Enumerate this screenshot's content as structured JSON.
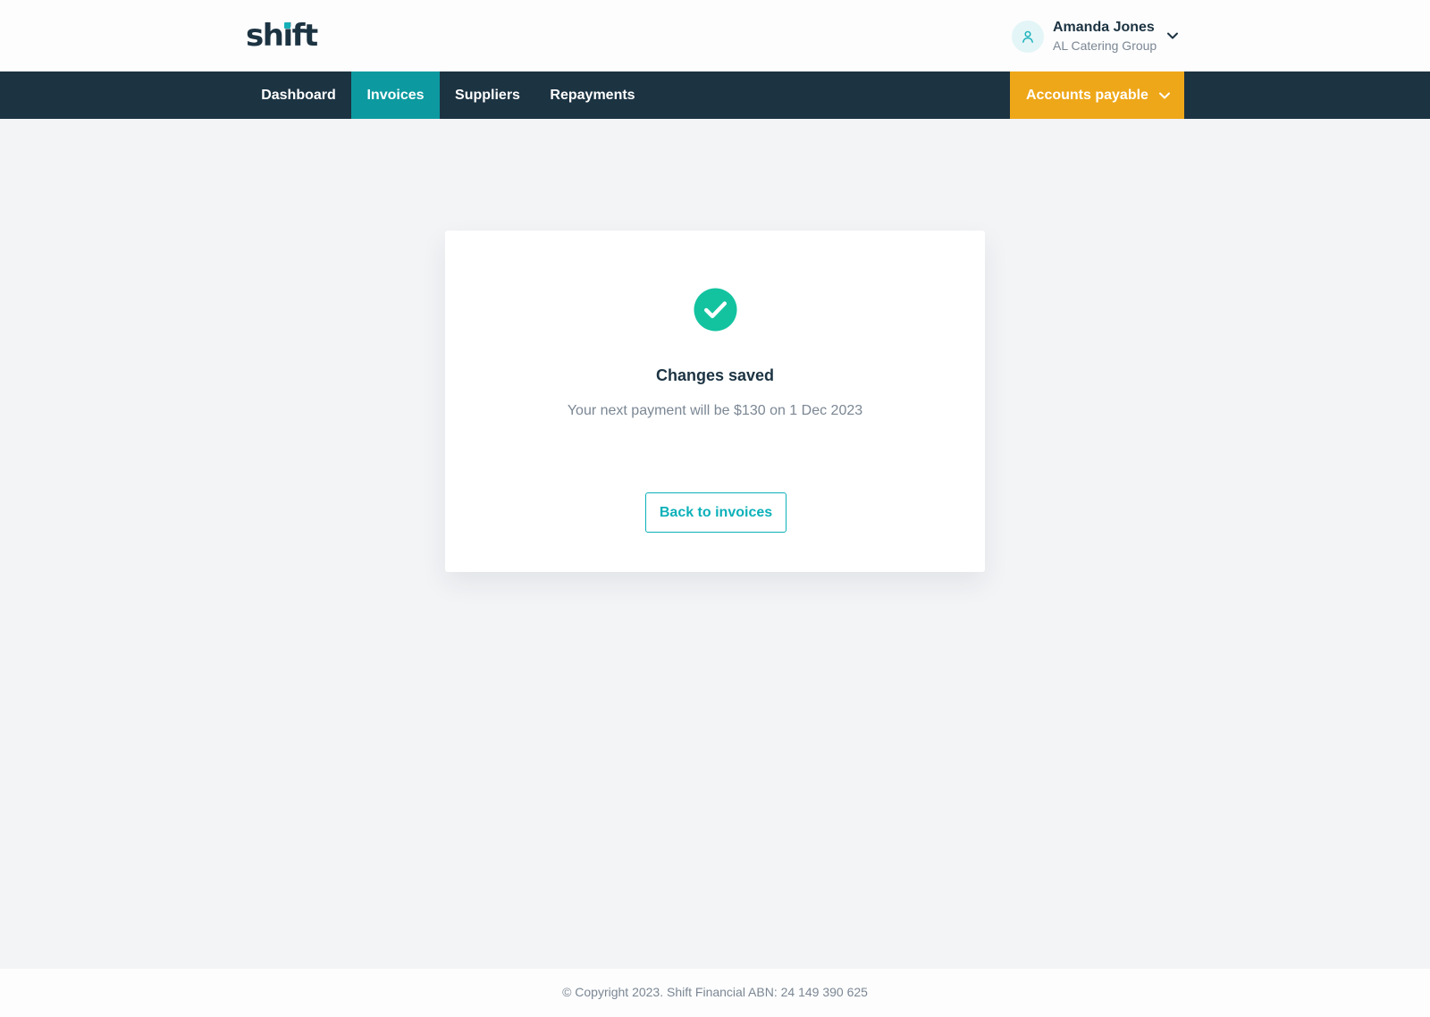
{
  "brand": {
    "logo_text_before": "sh",
    "logo_text_i": "i",
    "logo_text_after": "ft",
    "accent_color": "#15b0b8"
  },
  "user": {
    "name": "Amanda Jones",
    "org": "AL Catering Group",
    "avatar_icon": "user-icon",
    "menu_icon": "chevron-down-icon"
  },
  "nav": {
    "items": [
      {
        "label": "Dashboard",
        "active": false
      },
      {
        "label": "Invoices",
        "active": true
      },
      {
        "label": "Suppliers",
        "active": false
      },
      {
        "label": "Repayments",
        "active": false
      }
    ],
    "accounts_dropdown": {
      "label": "Accounts payable",
      "icon": "chevron-down-icon",
      "color": "#eea719"
    },
    "background_color": "#1c3342",
    "active_color": "#0c9aa0"
  },
  "confirmation": {
    "icon": "check-circle-icon",
    "icon_color": "#13c3a0",
    "title": "Changes saved",
    "message": "Your next payment will be $130 on 1 Dec 2023",
    "back_button_label": "Back to invoices"
  },
  "footer": {
    "copyright": "© Copyright 2023. Shift Financial ABN: 24 149 390 625"
  }
}
